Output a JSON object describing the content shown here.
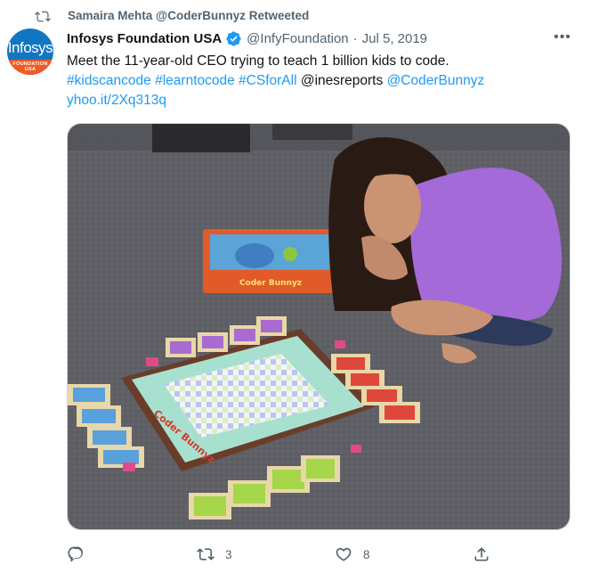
{
  "retweet": {
    "text": "Samaira Mehta @CoderBunnyz Retweeted"
  },
  "author": {
    "avatar_text": "Infosys",
    "avatar_band_text": "FOUNDATION USA",
    "name": "Infosys Foundation USA",
    "handle": "@InfyFoundation",
    "separator": "·",
    "date": "Jul 5, 2019",
    "verified": true
  },
  "tweet": {
    "line1": "Meet the 11-year-old CEO trying to teach 1 billion kids to code.",
    "hashtag1": "#kidscancode",
    "hashtag2": "#learntocode",
    "hashtag3": "#CSforAll",
    "mention1": "@inesreports",
    "mention2": "@CoderBunnyz",
    "url": "yhoo.it/2Xq313q"
  },
  "media": {
    "box_title": "Coder Bunnyz",
    "board_title": "Coder Bunnyz"
  },
  "actions": {
    "retweet_count": "3",
    "like_count": "8"
  },
  "colors": {
    "link": "#1d9bf0",
    "secondary_text": "#536471",
    "verified": "#1d9bf0",
    "brand_blue": "#1376c2",
    "brand_orange": "#f15a22"
  }
}
